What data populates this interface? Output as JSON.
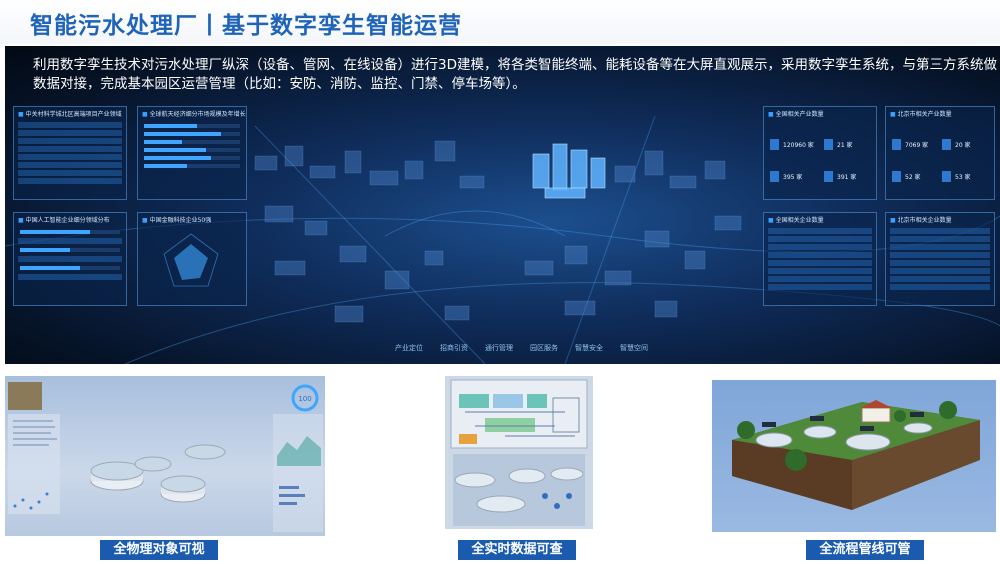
{
  "title": "智能污水处理厂丨基于数字孪生智能运营",
  "description": "利用数字孪生技术对污水处理厂纵深（设备、管网、在线设备）进行3D建模，将各类智能终端、能耗设备等在大屏直观展示，采用数字孪生系统，与第三方系统做数据对接，完成基本园区运营管理（比如：安防、消防、监控、门禁、停车场等）。",
  "dashboard": {
    "panels": {
      "p1": "中关村科学城北区高端项目产业领域",
      "p2": "全球航天经济细分市场规模及年增长",
      "p3": "中国人工智能企业细分领域分布",
      "p4": "中国金融科技企业50强",
      "p5": "全国相关产业数量",
      "p6": "北京市相关产业数量",
      "p7": "全国相关企业数量",
      "p8": "北京市相关企业数量"
    },
    "stats_national": [
      "120960 家",
      "21 家",
      "395 家",
      "391 家"
    ],
    "stats_beijing": [
      "7069 家",
      "20 家",
      "52 家",
      "53 家"
    ],
    "gauge_value": "100",
    "nav": [
      "产业定位",
      "招商引资",
      "通行管理",
      "园区服务",
      "智慧安全",
      "智慧空间"
    ]
  },
  "captions": {
    "c1": "全物理对象可视",
    "c2": "全实时数据可查",
    "c3": "全流程管线可管"
  },
  "colors": {
    "title": "#1f64b8",
    "caption_bg": "#1a5bb0",
    "hero_bg": "#0f2c5a"
  }
}
